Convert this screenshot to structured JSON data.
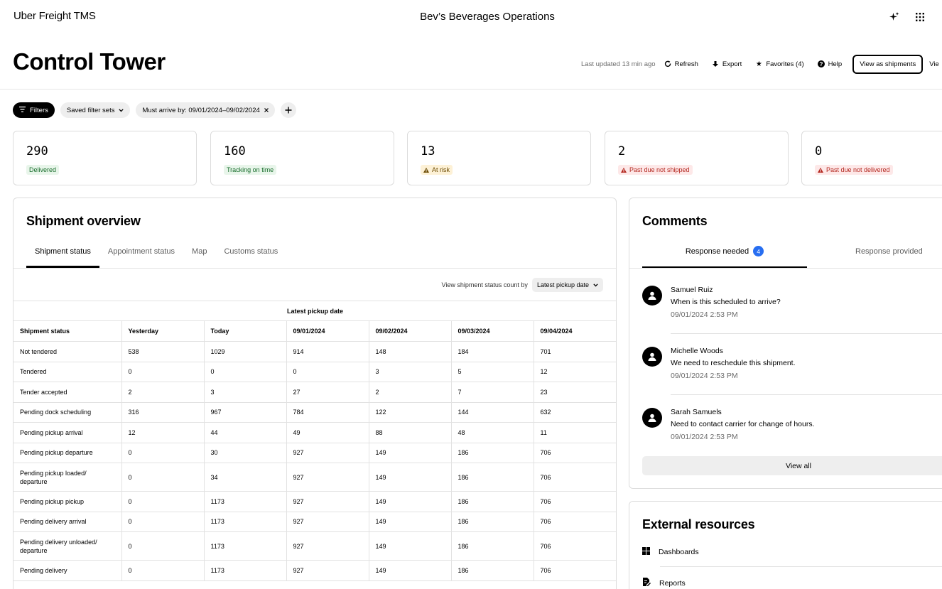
{
  "header": {
    "brand": "Uber Freight TMS",
    "org": "Bev’s Beverages Operations",
    "ai_icon": "sparkle-icon",
    "apps_icon": "grid-icon"
  },
  "page": {
    "title": "Control Tower",
    "last_updated": "Last updated 13 min ago",
    "refresh": "Refresh",
    "export": "Export",
    "favorites": "Favorites (4)",
    "help": "Help",
    "view_shipments": "View as shipments",
    "view_clipped": "Vie"
  },
  "filters": {
    "filters_label": "Filters",
    "saved_sets": "Saved filter sets",
    "active_filter": "Must arrive by: 09/01/2024–09/02/2024"
  },
  "kpis": [
    {
      "value": "290",
      "label": "Delivered",
      "status": "green"
    },
    {
      "value": "160",
      "label": "Tracking on time",
      "status": "green"
    },
    {
      "value": "13",
      "label": "At risk",
      "status": "yellow"
    },
    {
      "value": "2",
      "label": "Past due not shipped",
      "status": "red"
    },
    {
      "value": "0",
      "label": "Past due not delivered",
      "status": "red"
    }
  ],
  "overview": {
    "title": "Shipment overview",
    "tabs": [
      "Shipment status",
      "Appointment status",
      "Map",
      "Customs status"
    ],
    "view_by_label": "View shipment status count by",
    "view_by_value": "Latest pickup date",
    "group_header": "Latest pickup date",
    "columns": [
      "Shipment status",
      "Yesterday",
      "Today",
      "09/01/2024",
      "09/02/2024",
      "09/03/2024",
      "09/04/2024"
    ],
    "rows": [
      [
        "Not tendered",
        "538",
        "1029",
        "914",
        "148",
        "184",
        "701"
      ],
      [
        "Tendered",
        "0",
        "0",
        "0",
        "3",
        "5",
        "12"
      ],
      [
        "Tender accepted",
        "2",
        "3",
        "27",
        "2",
        "7",
        "23"
      ],
      [
        "Pending dock scheduling",
        "316",
        "967",
        "784",
        "122",
        "144",
        "632"
      ],
      [
        "Pending pickup arrival",
        "12",
        "44",
        "49",
        "88",
        "48",
        "11"
      ],
      [
        "Pending pickup departure",
        "0",
        "30",
        "927",
        "149",
        "186",
        "706"
      ],
      [
        "Pending pickup loaded/ departure",
        "0",
        "34",
        "927",
        "149",
        "186",
        "706"
      ],
      [
        "Pending pickup pickup",
        "0",
        "1173",
        "927",
        "149",
        "186",
        "706"
      ],
      [
        "Pending delivery arrival",
        "0",
        "1173",
        "927",
        "149",
        "186",
        "706"
      ],
      [
        "Pending delivery unloaded/ departure",
        "0",
        "1173",
        "927",
        "149",
        "186",
        "706"
      ],
      [
        "Pending delivery",
        "0",
        "1173",
        "927",
        "149",
        "186",
        "706"
      ]
    ]
  },
  "comments": {
    "title": "Comments",
    "tab_needed": "Response needed",
    "tab_needed_count": "4",
    "tab_provided": "Response provided",
    "items": [
      {
        "name": "Samuel Ruiz",
        "message": "When is this scheduled to arrive?",
        "time": "09/01/2024 2:53 PM"
      },
      {
        "name": "Michelle Woods",
        "message": "We need to reschedule this shipment.",
        "time": "09/01/2024 2:53 PM"
      },
      {
        "name": "Sarah Samuels",
        "message": "Need to contact carrier for change of hours.",
        "time": "09/01/2024 2:53 PM"
      }
    ],
    "view_all": "View all"
  },
  "external": {
    "title": "External resources",
    "items": [
      {
        "label": "Dashboards",
        "icon": "dashboard-icon"
      },
      {
        "label": "Reports",
        "icon": "report-icon"
      }
    ]
  },
  "colors": {
    "accent_blue": "#276ef1",
    "green_badge": "#166c2a",
    "yellow_badge": "#6b4a00",
    "red_badge": "#b3261e"
  }
}
